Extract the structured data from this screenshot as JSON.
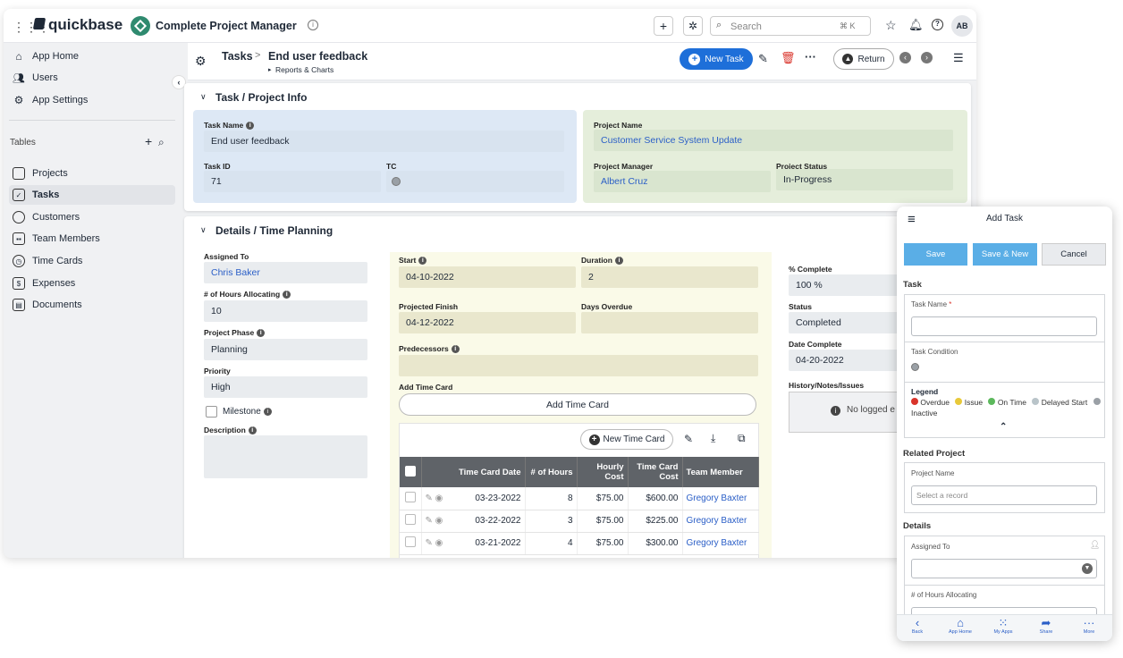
{
  "topbar": {
    "brand": "quickbase",
    "app_title": "Complete Project Manager",
    "search_placeholder": "Search",
    "search_shortcut": "⌘ K",
    "avatar": "AB"
  },
  "sidebar": {
    "nav": [
      {
        "label": "App Home",
        "icon": "home-icon"
      },
      {
        "label": "Users",
        "icon": "users-icon"
      },
      {
        "label": "App Settings",
        "icon": "gear-icon"
      }
    ],
    "tables_label": "Tables",
    "tables": [
      {
        "label": "Projects",
        "icon": "table-icon"
      },
      {
        "label": "Tasks",
        "icon": "task-icon"
      },
      {
        "label": "Customers",
        "icon": "smile-icon"
      },
      {
        "label": "Team Members",
        "icon": "team-icon"
      },
      {
        "label": "Time Cards",
        "icon": "clock-icon"
      },
      {
        "label": "Expenses",
        "icon": "dollar-icon"
      },
      {
        "label": "Documents",
        "icon": "documents-icon"
      }
    ]
  },
  "toolbar": {
    "table": "Tasks",
    "separator": ">",
    "record": "End user feedback",
    "sub": "Reports & Charts",
    "new_task": "New Task",
    "return": "Return"
  },
  "task_info": {
    "section_title": "Task / Project Info",
    "task_name_label": "Task Name",
    "task_name": "End user feedback",
    "task_id_label": "Task ID",
    "task_id": "71",
    "tc_label": "TC",
    "project_name_label": "Project Name",
    "project_name": "Customer Service System Update",
    "project_manager_label": "Project Manager",
    "project_manager": "Albert Cruz",
    "project_status_label": "Project Status",
    "project_status": "In-Progress"
  },
  "details": {
    "section_title": "Details / Time Planning",
    "assigned_to_label": "Assigned To",
    "assigned_to": "Chris Baker",
    "hours_label": "# of Hours Allocating",
    "hours": "10",
    "phase_label": "Project Phase",
    "phase": "Planning",
    "priority_label": "Priority",
    "priority": "High",
    "milestone_label": "Milestone",
    "description_label": "Description",
    "start_label": "Start",
    "start": "04-10-2022",
    "duration_label": "Duration",
    "duration": "2",
    "projected_finish_label": "Projected Finish",
    "projected_finish": "04-12-2022",
    "days_overdue_label": "Days Overdue",
    "predecessors_label": "Predecessors",
    "add_time_card_label": "Add Time Card",
    "add_time_card_button": "Add Time Card",
    "new_time_card": "New Time Card",
    "pct_complete_label": "% Complete",
    "pct_complete": "100 %",
    "status_label": "Status",
    "status": "Completed",
    "date_complete_label": "Date Complete",
    "date_complete": "04-20-2022",
    "history_label": "History/Notes/Issues",
    "no_logged": "No logged e"
  },
  "time_cards": {
    "headers": [
      "Time Card Date",
      "# of Hours",
      "Hourly Cost",
      "Time Card Cost",
      "Team Member"
    ],
    "rows": [
      {
        "date": "03-23-2022",
        "hours": "8",
        "rate": "$75.00",
        "cost": "$600.00",
        "member": "Gregory Baxter"
      },
      {
        "date": "03-22-2022",
        "hours": "3",
        "rate": "$75.00",
        "cost": "$225.00",
        "member": "Gregory Baxter"
      },
      {
        "date": "03-21-2022",
        "hours": "4",
        "rate": "$75.00",
        "cost": "$300.00",
        "member": "Gregory Baxter"
      }
    ]
  },
  "mobile": {
    "title": "Add Task",
    "save": "Save",
    "save_new": "Save & New",
    "cancel": "Cancel",
    "task_section": "Task",
    "task_name_label": "Task Name",
    "required_mark": "*",
    "task_condition_label": "Task Condition",
    "legend_title": "Legend",
    "legend": [
      {
        "label": "Overdue",
        "color": "#d9342b"
      },
      {
        "label": "Issue",
        "color": "#e8c93a"
      },
      {
        "label": "On Time",
        "color": "#5cb85c"
      },
      {
        "label": "Delayed Start",
        "color": "#b9c4c9"
      },
      {
        "label": "Inactive",
        "color": "#9aa0a6"
      }
    ],
    "related_project_section": "Related Project",
    "project_name_label": "Project Name",
    "project_placeholder": "Select a record",
    "details_section": "Details",
    "assigned_to_label": "Assigned To",
    "hours_label": "# of Hours Allocating",
    "nav": [
      {
        "label": "Back",
        "icon": "back-icon"
      },
      {
        "label": "App Home",
        "icon": "home-icon"
      },
      {
        "label": "My Apps",
        "icon": "grid-icon"
      },
      {
        "label": "Share",
        "icon": "share-icon"
      },
      {
        "label": "More",
        "icon": "more-icon"
      }
    ]
  },
  "colors": {
    "primary": "#1e6fd9",
    "danger": "#d9342b",
    "mobile_button": "#5aaee6"
  }
}
